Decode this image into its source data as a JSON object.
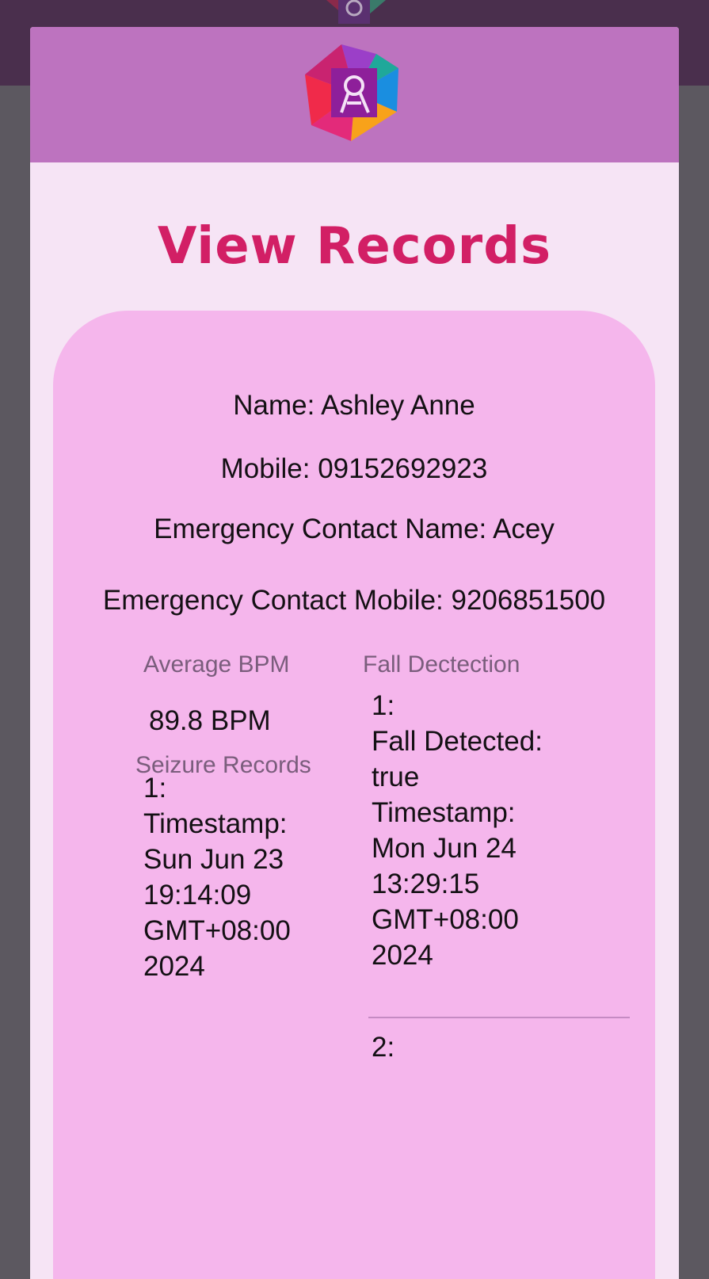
{
  "dialog": {
    "title": "View Records"
  },
  "record": {
    "name": "Name: Ashley Anne",
    "mobile": "Mobile: 09152692923",
    "emergency_name": "Emergency Contact Name: Acey",
    "emergency_mobile": "Emergency Contact Mobile: 9206851500"
  },
  "avg_bpm": {
    "label": "Average BPM",
    "value": "89.8 BPM"
  },
  "seizure": {
    "label": "Seizure Records",
    "items": [
      {
        "index": "1:",
        "lines": [
          "Timestamp:",
          "Sun Jun 23",
          "19:14:09",
          "GMT+08:00",
          "2024"
        ]
      }
    ]
  },
  "fall": {
    "label": "Fall Dectection",
    "items": [
      {
        "index": "1:",
        "lines": [
          "Fall Detected:",
          "true",
          "Timestamp:",
          "Mon Jun 24",
          "13:29:15",
          "GMT+08:00",
          "2024"
        ]
      },
      {
        "index": "2:"
      }
    ]
  },
  "colors": {
    "header": "#bd73bf",
    "title": "#d21f65",
    "card": "#f5b6ec",
    "dialog": "#f6e4f5"
  },
  "icons": {
    "logo": "ribbon-pinwheel-logo"
  }
}
